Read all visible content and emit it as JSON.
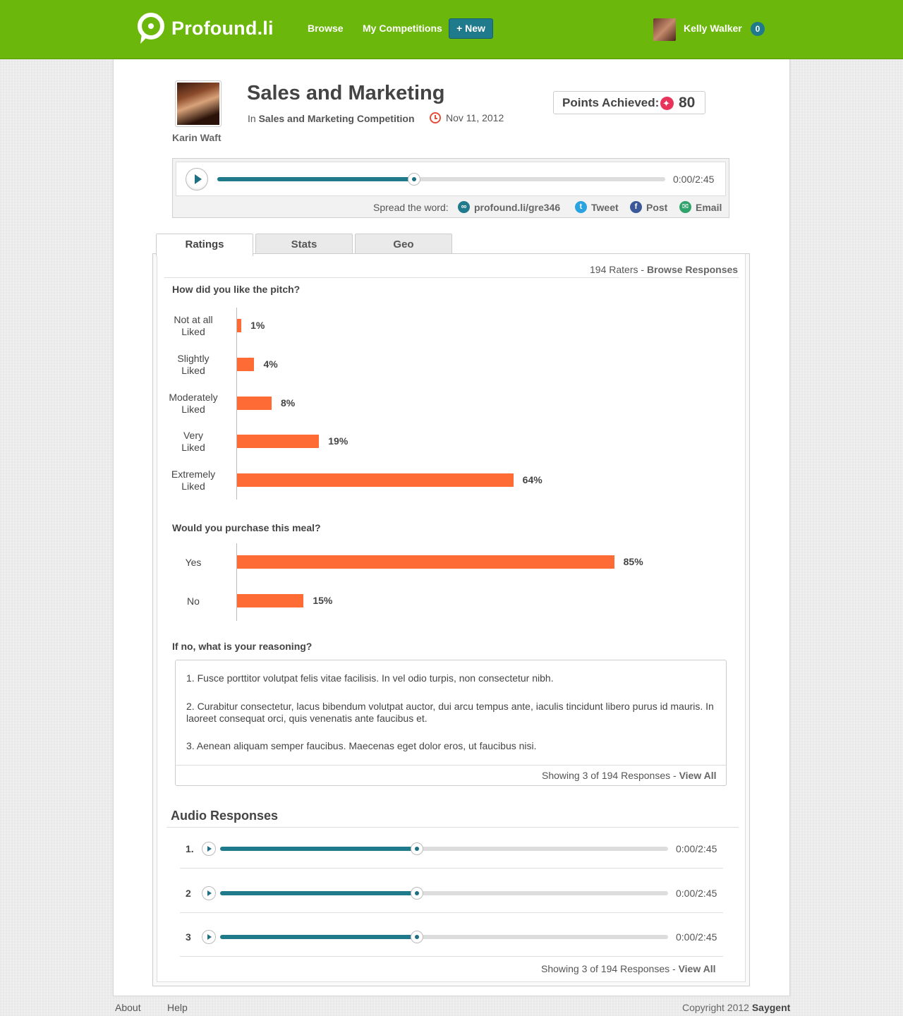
{
  "header": {
    "logo_text": "Profound.li",
    "nav": {
      "browse": "Browse",
      "my_competitions": "My Competitions",
      "new_button": "+ New"
    },
    "user": {
      "name": "Kelly Walker",
      "notifications": "0"
    },
    "brand_color": "#6cb70b"
  },
  "pitch": {
    "author": "Karin Waft",
    "title": "Sales and Marketing",
    "in_prefix": "In",
    "competition": "Sales and Marketing Competition",
    "date": "Nov 11, 2012",
    "points_label": "Points Achieved:",
    "points_value": "80"
  },
  "player": {
    "time": "0:00/2:45",
    "progress": 0.44,
    "spread_label": "Spread the word:",
    "share_link": "profound.li/gre346",
    "tweet": "Tweet",
    "post": "Post",
    "email": "Email"
  },
  "tabs": [
    {
      "label": "Ratings",
      "active": true
    },
    {
      "label": "Stats",
      "active": false
    },
    {
      "label": "Geo",
      "active": false
    }
  ],
  "ratings": {
    "raters_count": "194 Raters",
    "separator": " - ",
    "browse_responses": "Browse Responses",
    "accent_color": "#ff6b35"
  },
  "chart_data": [
    {
      "type": "bar",
      "title": "How did you like the pitch?",
      "categories": [
        "Not at all Liked",
        "Slightly Liked",
        "Moderately Liked",
        "Very Liked",
        "Extremely Liked"
      ],
      "label_lines": [
        [
          "Not at all",
          "Liked"
        ],
        [
          "Slightly",
          "Liked"
        ],
        [
          "Moderately",
          "Liked"
        ],
        [
          "Very",
          "Liked"
        ],
        [
          "Extremely",
          "Liked"
        ]
      ],
      "values": [
        1,
        4,
        8,
        19,
        64
      ],
      "value_labels": [
        "1%",
        "4%",
        "8%",
        "19%",
        "64%"
      ],
      "ylim": [
        0,
        100
      ]
    },
    {
      "type": "bar",
      "title": "Would you purchase this meal?",
      "categories": [
        "Yes",
        "No"
      ],
      "label_lines": [
        [
          "Yes"
        ],
        [
          "No"
        ]
      ],
      "values": [
        85,
        15
      ],
      "value_labels": [
        "85%",
        "15%"
      ],
      "ylim": [
        0,
        100
      ]
    }
  ],
  "reasoning": {
    "question": "If no, what is your reasoning?",
    "responses": [
      "1. Fusce porttitor volutpat felis vitae facilisis. In vel odio turpis, non consectetur nibh.",
      "2. Curabitur consectetur, lacus bibendum volutpat auctor, dui arcu tempus ante, iaculis tincidunt libero purus id mauris. In laoreet consequat orci, quis venenatis ante faucibus et.",
      "3. Aenean aliquam semper faucibus. Maecenas eget dolor eros, ut faucibus nisi."
    ],
    "showing": "Showing 3 of 194 Responses - ",
    "view_all": "View All"
  },
  "audio_responses": {
    "title": "Audio Responses",
    "items": [
      {
        "number": "1.",
        "time": "0:00/2:45",
        "progress": 0.44
      },
      {
        "number": "2",
        "time": "0:00/2:45",
        "progress": 0.44
      },
      {
        "number": "3",
        "time": "0:00/2:45",
        "progress": 0.44
      }
    ],
    "showing": "Showing 3 of 194 Responses - ",
    "view_all": "View All"
  },
  "footer": {
    "about": "About",
    "help": "Help",
    "copyright": "Copyright 2012",
    "company": "Saygent"
  }
}
